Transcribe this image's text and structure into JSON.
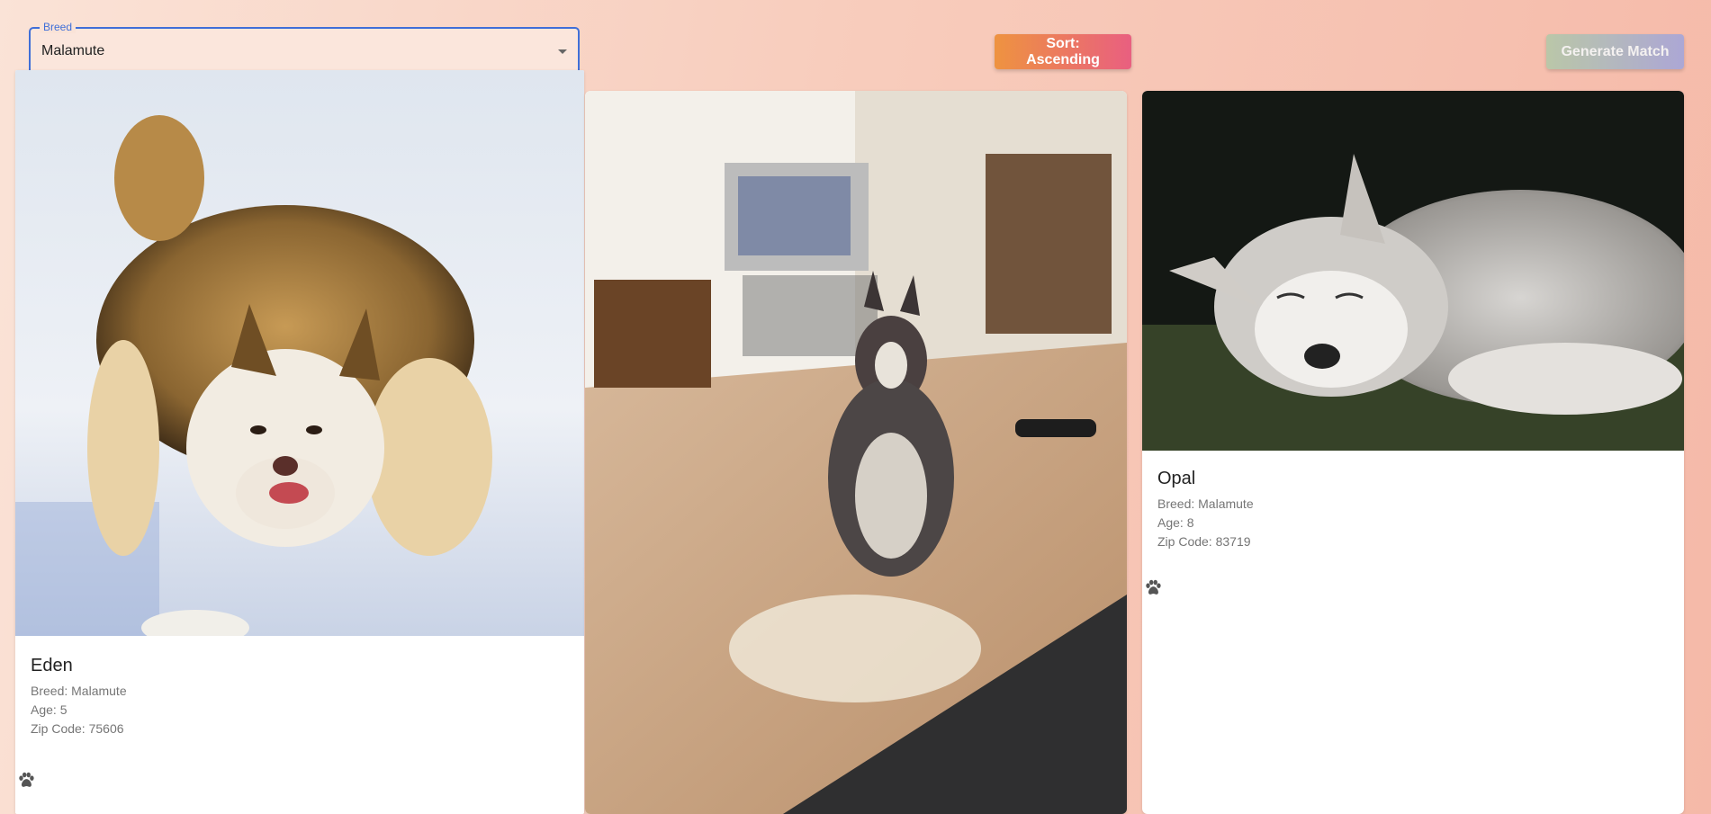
{
  "filter": {
    "label": "Breed",
    "value": "Malamute"
  },
  "toolbar": {
    "sort_label": "Sort: Ascending",
    "match_label": "Generate Match"
  },
  "dogs": [
    {
      "name": "Eden",
      "breed": "Breed: Malamute",
      "age": "Age: 5",
      "zip": "Zip Code: 75606"
    },
    {
      "name": "",
      "breed": "",
      "age": "",
      "zip": ""
    },
    {
      "name": "Opal",
      "breed": "Breed: Malamute",
      "age": "Age: 8",
      "zip": "Zip Code: 83719"
    }
  ],
  "icons": {
    "favorite": "paw-icon",
    "dropdown": "chevron-down-icon"
  },
  "colors": {
    "focus": "#3f6fd8",
    "sort_start": "#ee9340",
    "sort_end": "#e95f80",
    "match_start": "#b7c8a8",
    "match_end": "#a9a6d8"
  }
}
